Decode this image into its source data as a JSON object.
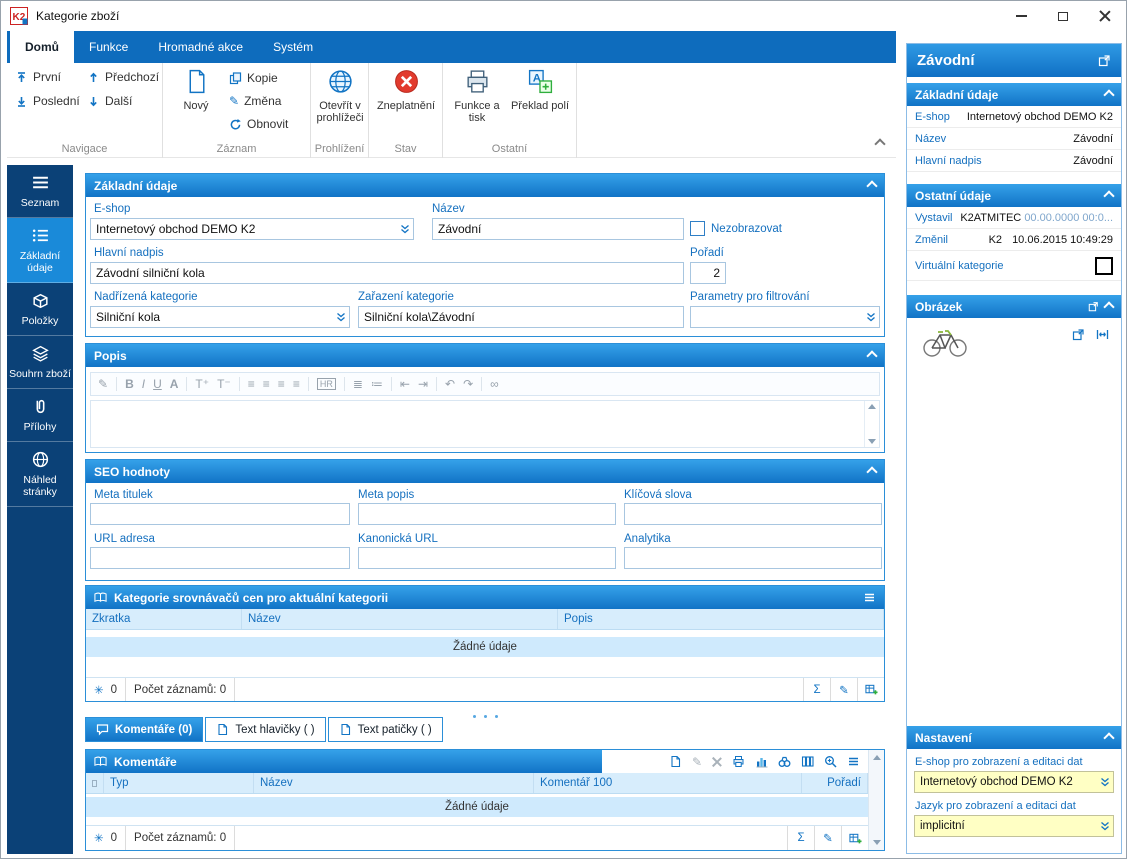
{
  "window": {
    "title": "Kategorie zboží"
  },
  "ribbon": {
    "tabs": [
      {
        "label": "Domů"
      },
      {
        "label": "Funkce"
      },
      {
        "label": "Hromadné akce"
      },
      {
        "label": "Systém"
      }
    ],
    "buttons": {
      "first": "První",
      "last": "Poslední",
      "previous": "Předchozí",
      "next": "Další",
      "new": "Nový",
      "copy": "Kopie",
      "change": "Změna",
      "refresh": "Obnovit",
      "open_in_browser": "Otevřít v prohlížeči",
      "invalidate": "Zneplatnění",
      "functions_print": "Funkce a tisk",
      "translate_fields": "Překlad polí"
    },
    "groups": {
      "navigation": "Navigace",
      "record": "Záznam",
      "browsing": "Prohlížení",
      "state": "Stav",
      "other": "Ostatní"
    }
  },
  "sidebar": {
    "items": [
      {
        "label": "Seznam"
      },
      {
        "label": "Základní údaje"
      },
      {
        "label": "Položky"
      },
      {
        "label": "Souhrn zboží"
      },
      {
        "label": "Přílohy"
      },
      {
        "label": "Náhled stránky"
      }
    ]
  },
  "basic": {
    "title": "Základní údaje",
    "eshop_label": "E-shop",
    "eshop_value": "Internetový obchod DEMO K2",
    "name_label": "Název",
    "name_value": "Závodní",
    "hide_label": "Nezobrazovat",
    "heading_label": "Hlavní nadpis",
    "heading_value": "Závodní silniční kola",
    "order_label": "Pořadí",
    "order_value": "2",
    "parent_label": "Nadřízená kategorie",
    "parent_value": "Silniční kola",
    "classification_label": "Zařazení kategorie",
    "classification_value": "Silniční kola\\Závodní",
    "filter_label": "Parametry pro filtrování",
    "filter_value": ""
  },
  "description": {
    "title": "Popis"
  },
  "seo": {
    "title": "SEO hodnoty",
    "meta_title_label": "Meta titulek",
    "meta_title_value": "",
    "meta_desc_label": "Meta popis",
    "meta_desc_value": "",
    "keywords_label": "Klíčová slova",
    "keywords_value": "",
    "url_label": "URL adresa",
    "url_value": "",
    "canonical_label": "Kanonická URL",
    "canonical_value": "",
    "analytics_label": "Analytika",
    "analytics_value": ""
  },
  "comparators": {
    "title": "Kategorie srovnávačů cen pro aktuální kategorii",
    "columns": [
      "Zkratka",
      "Název",
      "Popis"
    ],
    "empty": "Žádné údaje",
    "count": "0",
    "records": "Počet záznamů: 0"
  },
  "bottom_tabs": [
    {
      "label": "Komentáře (0)"
    },
    {
      "label": "Text hlavičky ( )"
    },
    {
      "label": "Text patičky ( )"
    }
  ],
  "comments": {
    "title": "Komentáře",
    "columns": [
      "Typ",
      "Název",
      "Komentář 100",
      "Pořadí"
    ],
    "empty": "Žádné údaje",
    "count": "0",
    "records": "Počet záznamů: 0"
  },
  "preview": {
    "title": "Závodní",
    "basic_title": "Základní údaje",
    "rows": [
      {
        "label": "E-shop",
        "value": "Internetový obchod DEMO K2"
      },
      {
        "label": "Název",
        "value": "Závodní"
      },
      {
        "label": "Hlavní nadpis",
        "value": "Závodní"
      }
    ],
    "other_title": "Ostatní údaje",
    "created_label": "Vystavil",
    "created_user": "K2ATMITEC",
    "created_datetime": "00.00.0000 00:0...",
    "changed_label": "Změnil",
    "changed_user": "K2",
    "changed_datetime": "10.06.2015 10:49:29",
    "virtual_label": "Virtuální kategorie",
    "image_title": "Obrázek",
    "settings_title": "Nastavení",
    "set_eshop_label": "E-shop pro zobrazení a editaci dat",
    "set_eshop_value": "Internetový obchod DEMO K2",
    "set_lang_label": "Jazyk pro zobrazení a editaci dat",
    "set_lang_value": "implicitní"
  },
  "editor": {
    "icons": {
      "edit": "✎",
      "bold": "B",
      "italic": "I",
      "underline": "U",
      "font_color": "A",
      "font_bigger": "T⁺",
      "font_smaller": "T⁻",
      "align": "≡",
      "hr": "HR",
      "ordered_list": "≣",
      "unordered_list": "≔",
      "outdent": "⇤",
      "indent": "⇥",
      "undo": "↶",
      "redo": "↷",
      "link": "∞"
    }
  },
  "glyphs": {
    "sum": "Σ",
    "asterisk": "✳",
    "edit": "✎"
  },
  "colors": {
    "accent": "#1274c6",
    "ribbon": "#0e6cbd",
    "sidebar": "#0b4177",
    "sidebar_active": "#1a8ad9",
    "label_blue": "#1570bf",
    "yellow_field": "#ffffc4",
    "invalid_red": "#e23b2e"
  }
}
